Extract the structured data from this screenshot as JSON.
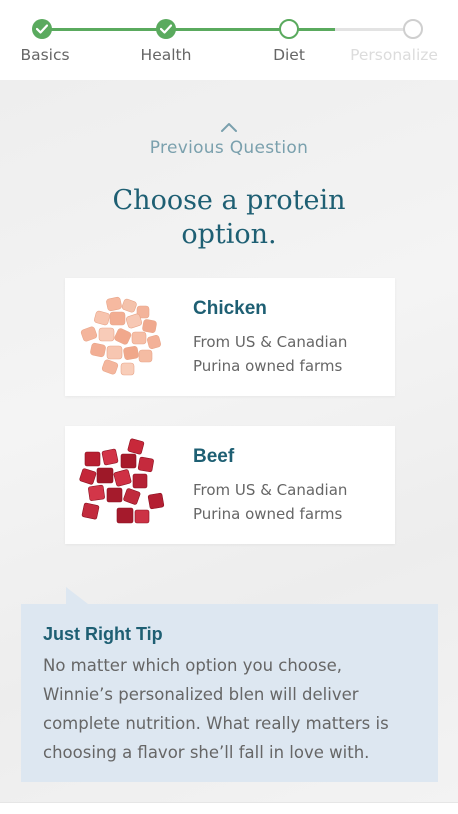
{
  "progress": {
    "steps": [
      {
        "label": "Basics",
        "state": "complete"
      },
      {
        "label": "Health",
        "state": "complete"
      },
      {
        "label": "Diet",
        "state": "current"
      },
      {
        "label": "Personalize",
        "state": "upcoming"
      }
    ]
  },
  "nav": {
    "previous_label": "Previous Question"
  },
  "question": {
    "line1": "Choose a protein",
    "line2": "option."
  },
  "options": [
    {
      "title": "Chicken",
      "desc_line1": "From US & Canadian",
      "desc_line2": "Purina owned farms",
      "icon": "chicken-pieces-image"
    },
    {
      "title": "Beef",
      "desc_line1": "From US & Canadian",
      "desc_line2": "Purina owned farms",
      "icon": "beef-pieces-image"
    }
  ],
  "tip": {
    "title": "Just Right Tip",
    "lines": [
      "No matter which option you choose,",
      "Winnie’s personalized blen will deliver",
      "complete nutrition. What really matters is",
      "choosing a flavor she’ll fall in love with."
    ]
  },
  "colors": {
    "accent": "#5aaa5e",
    "heading": "#1e5f73",
    "tip_bg": "#dde7f1"
  }
}
